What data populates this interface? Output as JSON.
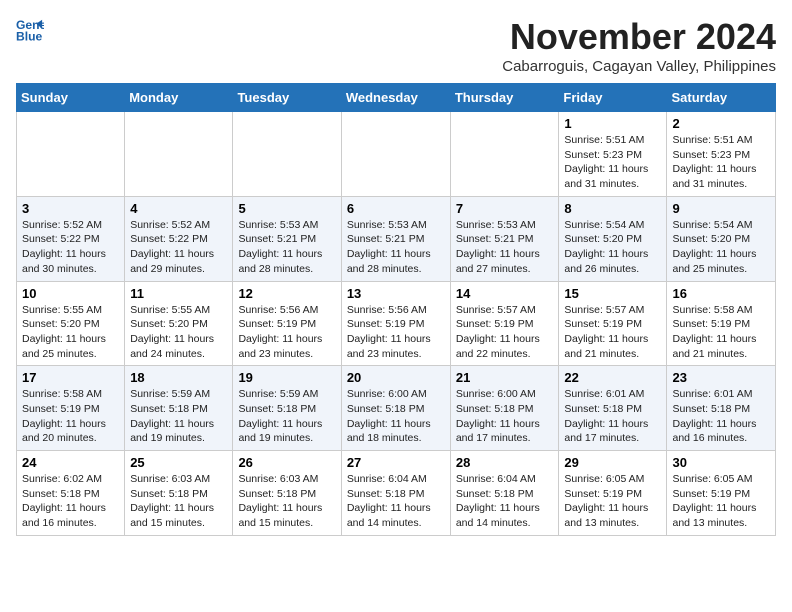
{
  "header": {
    "logo_line1": "General",
    "logo_line2": "Blue",
    "month": "November 2024",
    "location": "Cabarroguis, Cagayan Valley, Philippines"
  },
  "days_of_week": [
    "Sunday",
    "Monday",
    "Tuesday",
    "Wednesday",
    "Thursday",
    "Friday",
    "Saturday"
  ],
  "weeks": [
    [
      {
        "day": "",
        "info": ""
      },
      {
        "day": "",
        "info": ""
      },
      {
        "day": "",
        "info": ""
      },
      {
        "day": "",
        "info": ""
      },
      {
        "day": "",
        "info": ""
      },
      {
        "day": "1",
        "info": "Sunrise: 5:51 AM\nSunset: 5:23 PM\nDaylight: 11 hours and 31 minutes."
      },
      {
        "day": "2",
        "info": "Sunrise: 5:51 AM\nSunset: 5:23 PM\nDaylight: 11 hours and 31 minutes."
      }
    ],
    [
      {
        "day": "3",
        "info": "Sunrise: 5:52 AM\nSunset: 5:22 PM\nDaylight: 11 hours and 30 minutes."
      },
      {
        "day": "4",
        "info": "Sunrise: 5:52 AM\nSunset: 5:22 PM\nDaylight: 11 hours and 29 minutes."
      },
      {
        "day": "5",
        "info": "Sunrise: 5:53 AM\nSunset: 5:21 PM\nDaylight: 11 hours and 28 minutes."
      },
      {
        "day": "6",
        "info": "Sunrise: 5:53 AM\nSunset: 5:21 PM\nDaylight: 11 hours and 28 minutes."
      },
      {
        "day": "7",
        "info": "Sunrise: 5:53 AM\nSunset: 5:21 PM\nDaylight: 11 hours and 27 minutes."
      },
      {
        "day": "8",
        "info": "Sunrise: 5:54 AM\nSunset: 5:20 PM\nDaylight: 11 hours and 26 minutes."
      },
      {
        "day": "9",
        "info": "Sunrise: 5:54 AM\nSunset: 5:20 PM\nDaylight: 11 hours and 25 minutes."
      }
    ],
    [
      {
        "day": "10",
        "info": "Sunrise: 5:55 AM\nSunset: 5:20 PM\nDaylight: 11 hours and 25 minutes."
      },
      {
        "day": "11",
        "info": "Sunrise: 5:55 AM\nSunset: 5:20 PM\nDaylight: 11 hours and 24 minutes."
      },
      {
        "day": "12",
        "info": "Sunrise: 5:56 AM\nSunset: 5:19 PM\nDaylight: 11 hours and 23 minutes."
      },
      {
        "day": "13",
        "info": "Sunrise: 5:56 AM\nSunset: 5:19 PM\nDaylight: 11 hours and 23 minutes."
      },
      {
        "day": "14",
        "info": "Sunrise: 5:57 AM\nSunset: 5:19 PM\nDaylight: 11 hours and 22 minutes."
      },
      {
        "day": "15",
        "info": "Sunrise: 5:57 AM\nSunset: 5:19 PM\nDaylight: 11 hours and 21 minutes."
      },
      {
        "day": "16",
        "info": "Sunrise: 5:58 AM\nSunset: 5:19 PM\nDaylight: 11 hours and 21 minutes."
      }
    ],
    [
      {
        "day": "17",
        "info": "Sunrise: 5:58 AM\nSunset: 5:19 PM\nDaylight: 11 hours and 20 minutes."
      },
      {
        "day": "18",
        "info": "Sunrise: 5:59 AM\nSunset: 5:18 PM\nDaylight: 11 hours and 19 minutes."
      },
      {
        "day": "19",
        "info": "Sunrise: 5:59 AM\nSunset: 5:18 PM\nDaylight: 11 hours and 19 minutes."
      },
      {
        "day": "20",
        "info": "Sunrise: 6:00 AM\nSunset: 5:18 PM\nDaylight: 11 hours and 18 minutes."
      },
      {
        "day": "21",
        "info": "Sunrise: 6:00 AM\nSunset: 5:18 PM\nDaylight: 11 hours and 17 minutes."
      },
      {
        "day": "22",
        "info": "Sunrise: 6:01 AM\nSunset: 5:18 PM\nDaylight: 11 hours and 17 minutes."
      },
      {
        "day": "23",
        "info": "Sunrise: 6:01 AM\nSunset: 5:18 PM\nDaylight: 11 hours and 16 minutes."
      }
    ],
    [
      {
        "day": "24",
        "info": "Sunrise: 6:02 AM\nSunset: 5:18 PM\nDaylight: 11 hours and 16 minutes."
      },
      {
        "day": "25",
        "info": "Sunrise: 6:03 AM\nSunset: 5:18 PM\nDaylight: 11 hours and 15 minutes."
      },
      {
        "day": "26",
        "info": "Sunrise: 6:03 AM\nSunset: 5:18 PM\nDaylight: 11 hours and 15 minutes."
      },
      {
        "day": "27",
        "info": "Sunrise: 6:04 AM\nSunset: 5:18 PM\nDaylight: 11 hours and 14 minutes."
      },
      {
        "day": "28",
        "info": "Sunrise: 6:04 AM\nSunset: 5:18 PM\nDaylight: 11 hours and 14 minutes."
      },
      {
        "day": "29",
        "info": "Sunrise: 6:05 AM\nSunset: 5:19 PM\nDaylight: 11 hours and 13 minutes."
      },
      {
        "day": "30",
        "info": "Sunrise: 6:05 AM\nSunset: 5:19 PM\nDaylight: 11 hours and 13 minutes."
      }
    ]
  ]
}
